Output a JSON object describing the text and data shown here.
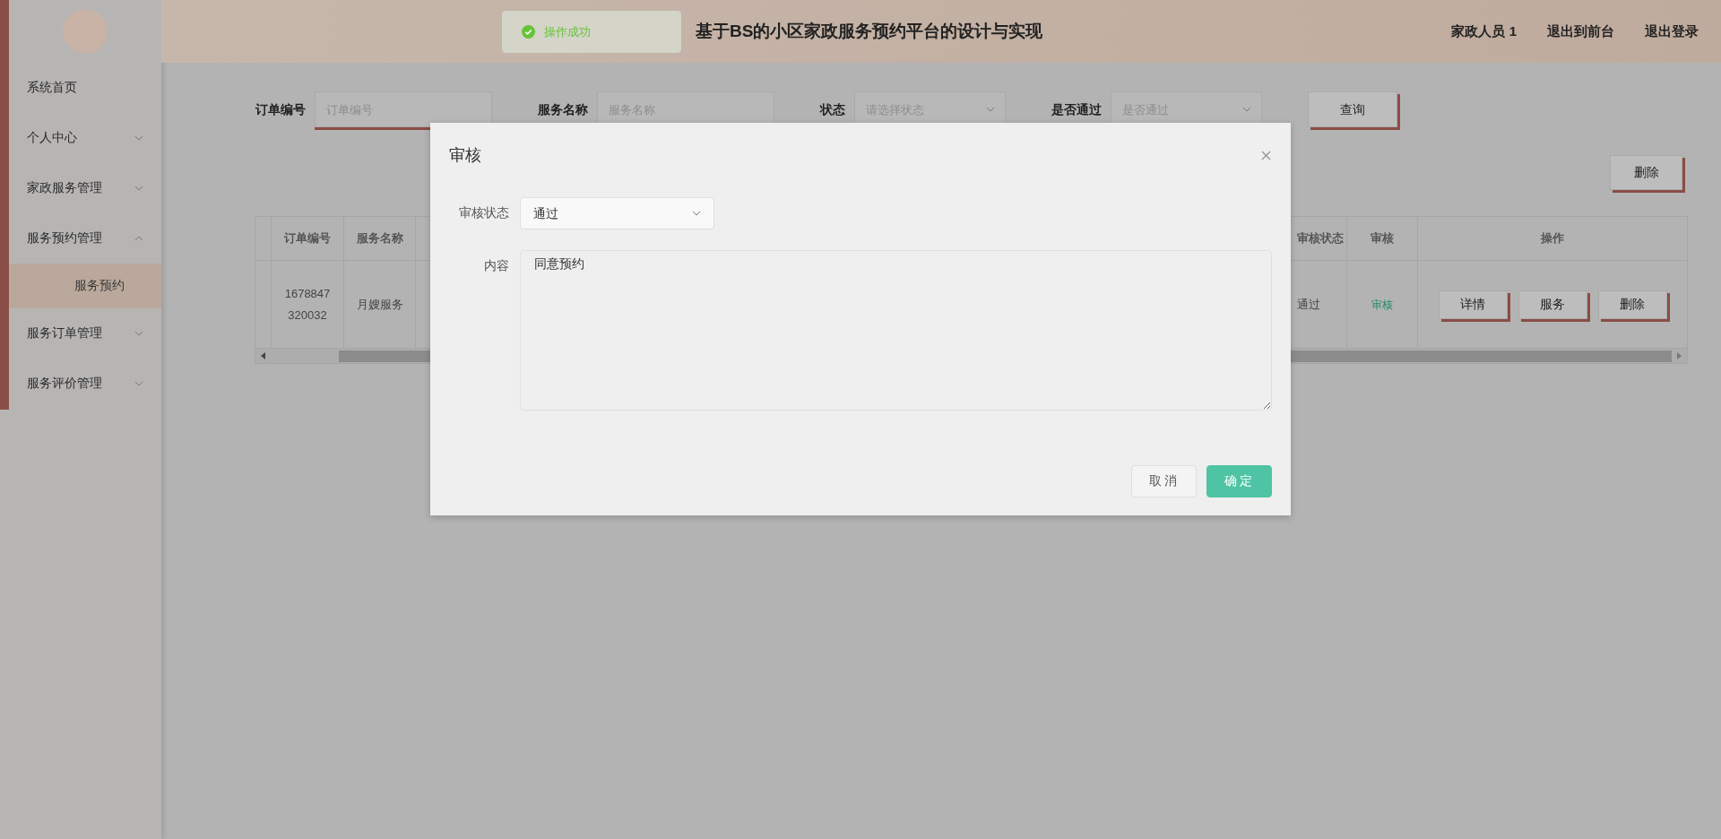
{
  "header": {
    "title": "基于BS的小区家政服务预约平台的设计与实现",
    "links": [
      "家政人员 1",
      "退出到前台",
      "退出登录"
    ]
  },
  "toast": {
    "message": "操作成功",
    "kind": "success"
  },
  "sidebar": {
    "items": [
      {
        "label": "系统首页",
        "kind": "link",
        "selected": false
      },
      {
        "label": "个人中心",
        "kind": "menu",
        "expanded": false,
        "selected": false
      },
      {
        "label": "家政服务管理",
        "kind": "menu",
        "expanded": false,
        "selected": false
      },
      {
        "label": "服务预约管理",
        "kind": "menu",
        "expanded": true,
        "selected": false,
        "children": [
          {
            "label": "服务预约",
            "selected": true
          }
        ]
      },
      {
        "label": "服务订单管理",
        "kind": "menu",
        "expanded": false,
        "selected": false
      },
      {
        "label": "服务评价管理",
        "kind": "menu",
        "expanded": false,
        "selected": false
      }
    ]
  },
  "search": {
    "fields": [
      {
        "label": "订单编号",
        "placeholder": "订单编号",
        "kind": "input"
      },
      {
        "label": "服务名称",
        "placeholder": "服务名称",
        "kind": "input"
      },
      {
        "label": "状态",
        "placeholder": "请选择状态",
        "kind": "select"
      },
      {
        "label": "是否通过",
        "placeholder": "是否通过",
        "kind": "select"
      }
    ],
    "button": "查询"
  },
  "delete_button": "删除",
  "table": {
    "left_columns": [
      "订单编号",
      "服务名称"
    ],
    "right_columns": [
      "审核状态",
      "审核",
      "操作"
    ],
    "rows": [
      {
        "order_no": "1678847320032",
        "service": "月嫂服务",
        "review_status": "通过",
        "review_link": "审核",
        "actions": [
          "详情",
          "服务",
          "删除"
        ]
      }
    ]
  },
  "dialog": {
    "title": "审核",
    "fields": [
      {
        "label": "审核状态",
        "kind": "select",
        "value": "通过"
      },
      {
        "label": "内容",
        "kind": "textarea",
        "value": "同意预约"
      }
    ],
    "buttons": [
      {
        "label": "取消",
        "kind": "default"
      },
      {
        "label": "确定",
        "kind": "primary"
      }
    ]
  }
}
